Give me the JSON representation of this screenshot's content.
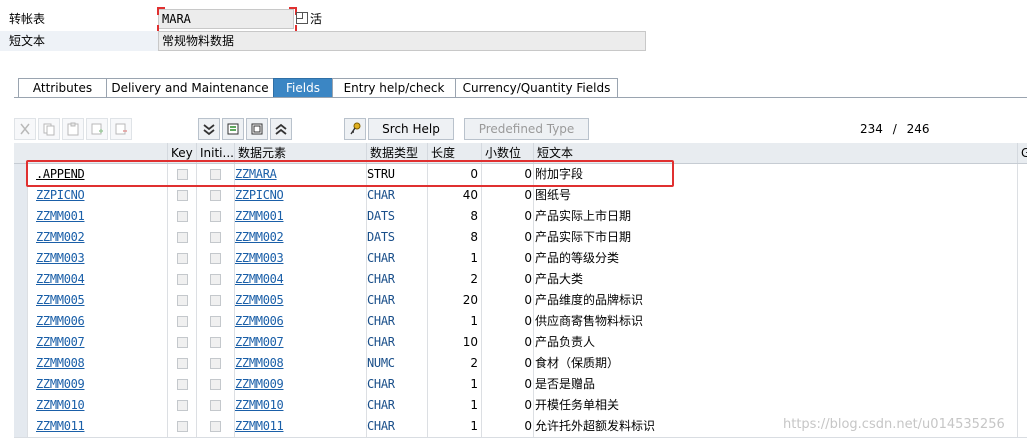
{
  "header": {
    "table_label": "转帐表",
    "table_value": "MARA",
    "status_text": "活",
    "short_text_label": "短文本",
    "short_text_value": "常规物料数据"
  },
  "tabs": [
    {
      "label": "Attributes",
      "active": false
    },
    {
      "label": "Delivery and Maintenance",
      "active": false
    },
    {
      "label": "Fields",
      "active": true
    },
    {
      "label": "Entry help/check",
      "active": false
    },
    {
      "label": "Currency/Quantity Fields",
      "active": false
    }
  ],
  "toolbar": {
    "srch_help_label": "Srch Help",
    "predefined_type_label": "Predefined Type",
    "counter_current": "234",
    "counter_sep": "/",
    "counter_total": "246"
  },
  "grid": {
    "columns": [
      "Key",
      "Initi...",
      "数据元素",
      "数据类型",
      "长度",
      "小数位",
      "短文本",
      "G"
    ],
    "rows": [
      {
        "field": ".APPEND",
        "element": "ZZMARA",
        "type": "STRU",
        "length": "0",
        "decimals": "0",
        "text": "附加字段"
      },
      {
        "field": "ZZPICNO",
        "element": "ZZPICNO",
        "type": "CHAR",
        "length": "40",
        "decimals": "0",
        "text": "图纸号"
      },
      {
        "field": "ZZMM001",
        "element": "ZZMM001",
        "type": "DATS",
        "length": "8",
        "decimals": "0",
        "text": "产品实际上市日期"
      },
      {
        "field": "ZZMM002",
        "element": "ZZMM002",
        "type": "DATS",
        "length": "8",
        "decimals": "0",
        "text": "产品实际下市日期"
      },
      {
        "field": "ZZMM003",
        "element": "ZZMM003",
        "type": "CHAR",
        "length": "1",
        "decimals": "0",
        "text": "产品的等级分类"
      },
      {
        "field": "ZZMM004",
        "element": "ZZMM004",
        "type": "CHAR",
        "length": "2",
        "decimals": "0",
        "text": "产品大类"
      },
      {
        "field": "ZZMM005",
        "element": "ZZMM005",
        "type": "CHAR",
        "length": "20",
        "decimals": "0",
        "text": "产品维度的品牌标识"
      },
      {
        "field": "ZZMM006",
        "element": "ZZMM006",
        "type": "CHAR",
        "length": "1",
        "decimals": "0",
        "text": "供应商寄售物料标识"
      },
      {
        "field": "ZZMM007",
        "element": "ZZMM007",
        "type": "CHAR",
        "length": "10",
        "decimals": "0",
        "text": "产品负责人"
      },
      {
        "field": "ZZMM008",
        "element": "ZZMM008",
        "type": "NUMC",
        "length": "2",
        "decimals": "0",
        "text": "食材（保质期）"
      },
      {
        "field": "ZZMM009",
        "element": "ZZMM009",
        "type": "CHAR",
        "length": "1",
        "decimals": "0",
        "text": "是否是赠品"
      },
      {
        "field": "ZZMM010",
        "element": "ZZMM010",
        "type": "CHAR",
        "length": "1",
        "decimals": "0",
        "text": "开模任务单相关"
      },
      {
        "field": "ZZMM011",
        "element": "ZZMM011",
        "type": "CHAR",
        "length": "1",
        "decimals": "0",
        "text": "允许托外超额发料标识"
      }
    ]
  },
  "watermark": "https://blog.csdn.net/u014535256",
  "colors": {
    "accent": "#3b86c4",
    "highlight": "#e03030",
    "link": "#1a5fa8"
  }
}
